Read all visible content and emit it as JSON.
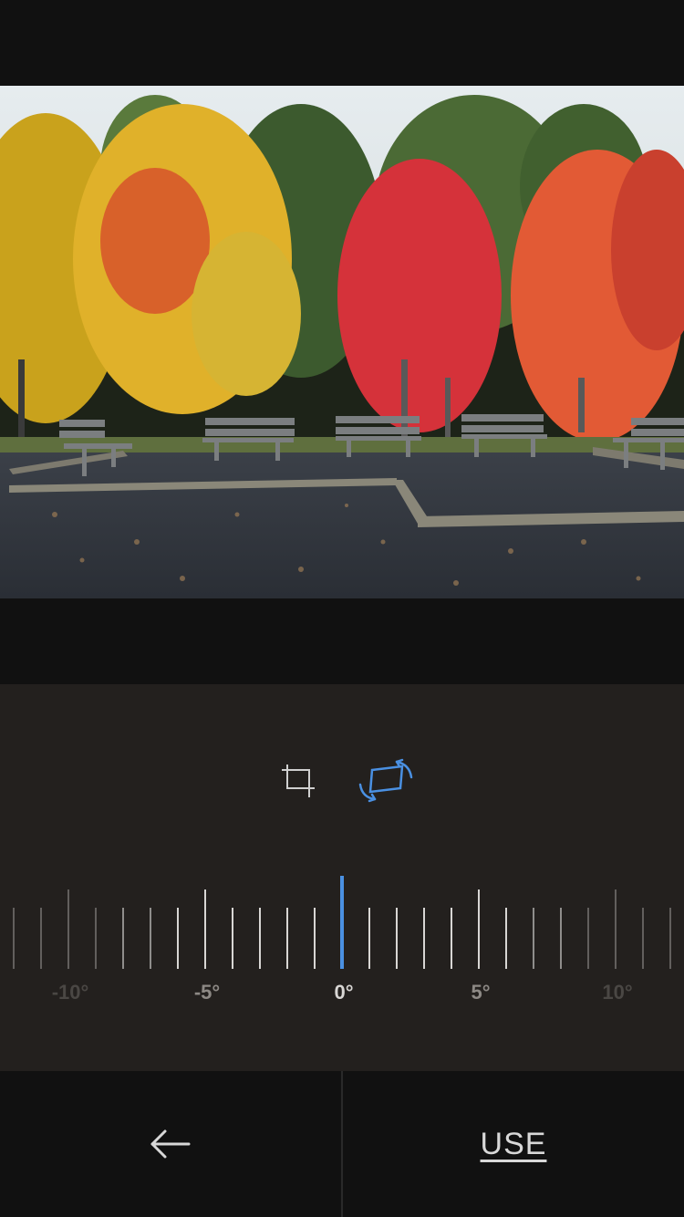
{
  "editor": {
    "photo_description": "autumn trees with benches",
    "tools": [
      {
        "name": "crop",
        "icon": "crop-icon",
        "active": false
      },
      {
        "name": "straighten",
        "icon": "rotate-straighten-icon",
        "active": true
      }
    ],
    "accent_color": "#4a90e2"
  },
  "ruler": {
    "current_angle": "0°",
    "labels": [
      "-10°",
      "-5°",
      "0°",
      "5°",
      "10°"
    ]
  },
  "footer": {
    "back_icon": "arrow-left-icon",
    "use_label": "USE"
  }
}
